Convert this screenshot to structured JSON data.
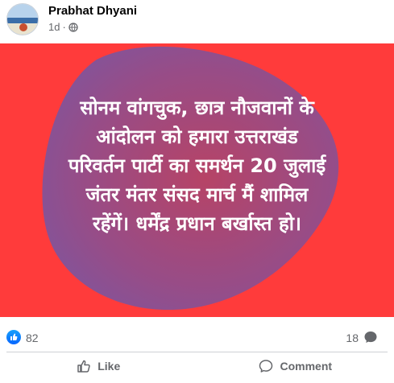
{
  "post": {
    "author": "Prabhat Dhyani",
    "time": "1d",
    "separator": "·",
    "privacy_icon": "globe-icon",
    "image_text": "सोनम वांगचुक, छात्र नौजवानों के\nआंदोलन को हमारा उत्तराखंड\nपरिवर्तन पार्टी का समर्थन 20 जुलाई\nजंतर मंतर संसद मार्च मैं शामिल\nरहेंगें। धर्मेंद्र प्रधान बर्खास्त हो।",
    "background_color": "#ff3b3b",
    "blob_color": "#b0446a"
  },
  "stats": {
    "reactions_count": "82",
    "comments_count": "18",
    "reaction_icon": "like-icon"
  },
  "actions": {
    "like_label": "Like",
    "comment_label": "Comment"
  }
}
